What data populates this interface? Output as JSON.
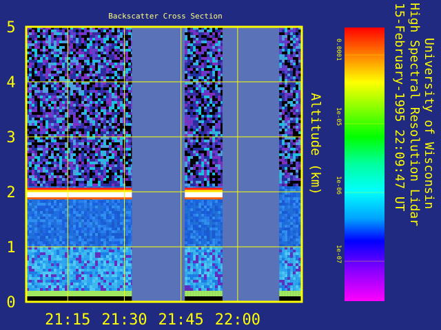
{
  "chart_data": {
    "type": "heatmap",
    "title": "Backscatter Cross Section",
    "ylabel": "Altitude (km)",
    "ylim": [
      0,
      5
    ],
    "yticks": [
      "0",
      "1",
      "2",
      "3",
      "4",
      "5"
    ],
    "xticks": [
      "21:15",
      "21:30",
      "21:45",
      "22:00"
    ],
    "xtick_values_min": [
      1275,
      1290,
      1305,
      1320
    ],
    "xlim_min": [
      1264,
      1337
    ],
    "no_data_intervals_min": [
      [
        1292,
        1306
      ],
      [
        1316,
        1331
      ]
    ],
    "features": [
      {
        "kind": "cloud layer",
        "altitude_km": 2.0,
        "intervals_min": [
          [
            1264,
            1292
          ],
          [
            1306,
            1316
          ]
        ]
      },
      {
        "kind": "boundary layer",
        "top_km": 1.0
      },
      {
        "kind": "aerosol layer",
        "top_km": 1.9
      }
    ],
    "colorbar": {
      "scale": "log",
      "ticks": [
        "0.0001",
        "1e-05",
        "1e-06",
        "1e-07"
      ],
      "colors": [
        "#ff0000",
        "#ff8000",
        "#ffff00",
        "#80ff00",
        "#00ff00",
        "#00ffa0",
        "#00ffff",
        "#00a0ff",
        "#0000ff",
        "#8000ff",
        "#ff00ff"
      ]
    },
    "side_title": [
      "University of Wisconsin",
      "High Spectral Resolution Lidar",
      "15-February-1995 22:09:47 UT"
    ]
  }
}
